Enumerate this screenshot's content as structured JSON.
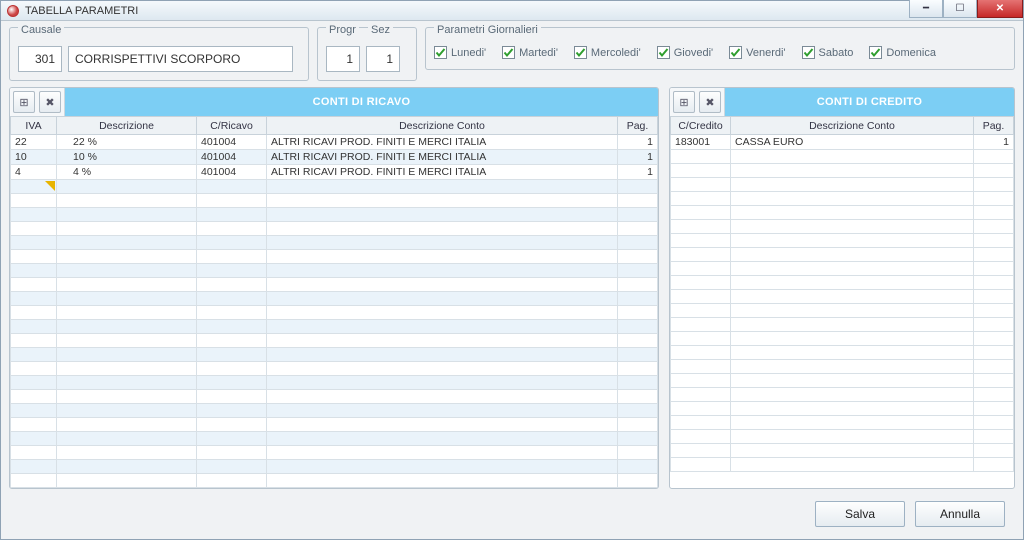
{
  "window": {
    "title": "TABELLA PARAMETRI"
  },
  "causale": {
    "label": "Causale",
    "code": "301",
    "desc": "CORRISPETTIVI SCORPORO"
  },
  "progr": {
    "label1": "Progr",
    "label2": "Sez",
    "progr": "1",
    "sez": "1"
  },
  "daily": {
    "label": "Parametri Giornalieri",
    "days": [
      "Lunedi'",
      "Martedi'",
      "Mercoledi'",
      "Giovedi'",
      "Venerdi'",
      "Sabato",
      "Domenica"
    ]
  },
  "ricavo": {
    "title": "CONTI DI RICAVO",
    "cols": [
      "IVA",
      "Descrizione",
      "C/Ricavo",
      "Descrizione Conto",
      "Pag."
    ],
    "rows": [
      {
        "iva": "22",
        "desc": "22 %",
        "cr": "401004",
        "dc": "ALTRI RICAVI PROD. FINITI E MERCI ITALIA",
        "pag": "1"
      },
      {
        "iva": "10",
        "desc": "10 %",
        "cr": "401004",
        "dc": "ALTRI RICAVI PROD. FINITI E MERCI ITALIA",
        "pag": "1"
      },
      {
        "iva": "4",
        "desc": "4 %",
        "cr": "401004",
        "dc": "ALTRI RICAVI PROD. FINITI E MERCI ITALIA",
        "pag": "1"
      }
    ],
    "blank_row_count": 21
  },
  "credito": {
    "title": "CONTI DI CREDITO",
    "cols": [
      "C/Credito",
      "Descrizione Conto",
      "Pag."
    ],
    "rows": [
      {
        "cc": "183001",
        "dc": "CASSA EURO",
        "pag": "1"
      }
    ],
    "blank_row_count": 23
  },
  "buttons": {
    "save": "Salva",
    "cancel": "Annulla"
  },
  "icons": {
    "new": "+",
    "delete": "✕"
  }
}
